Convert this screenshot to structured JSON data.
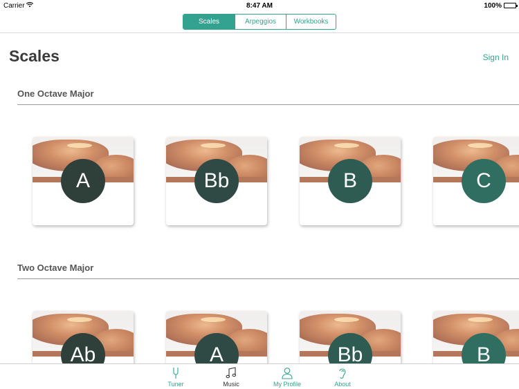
{
  "status": {
    "carrier": "Carrier",
    "time": "8:47 AM",
    "battery": "100%"
  },
  "segments": [
    {
      "label": "Scales",
      "active": true
    },
    {
      "label": "Arpeggios",
      "active": false
    },
    {
      "label": "Workbooks",
      "active": false
    }
  ],
  "page": {
    "title": "Scales",
    "sign_in": "Sign In"
  },
  "sections": [
    {
      "title": "One Octave Major",
      "cards": [
        "A",
        "Bb",
        "B",
        "C"
      ]
    },
    {
      "title": "Two Octave Major",
      "cards": [
        "Ab",
        "A",
        "Bb",
        "B"
      ]
    }
  ],
  "badge_colors": [
    "#2f3f3a",
    "#2f4a44",
    "#2f5c52",
    "#2f6e60"
  ],
  "tabs": [
    {
      "label": "Tuner",
      "icon": "tuning-fork-icon",
      "active": false
    },
    {
      "label": "Music",
      "icon": "music-note-icon",
      "active": true
    },
    {
      "label": "My Profile",
      "icon": "person-icon",
      "active": false
    },
    {
      "label": "About",
      "icon": "ear-icon",
      "active": false
    }
  ],
  "colors": {
    "accent": "#33a38f",
    "tab_active": "#333333"
  }
}
